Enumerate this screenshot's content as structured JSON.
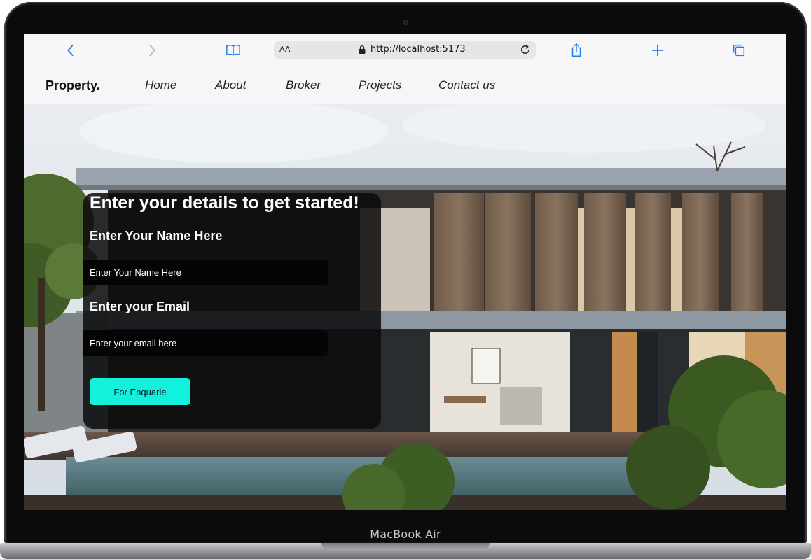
{
  "device": {
    "label": "MacBook Air"
  },
  "browser": {
    "text_size_label": "AA",
    "url": "http://localhost:5173",
    "icons": [
      "back-icon",
      "forward-icon",
      "bookmarks-icon",
      "lock-icon",
      "reload-icon",
      "share-icon",
      "new-tab-icon",
      "tabs-icon"
    ]
  },
  "site": {
    "logo": "Property.",
    "nav": [
      {
        "label": "Home"
      },
      {
        "label": "About"
      },
      {
        "label": "Broker"
      },
      {
        "label": "Projects"
      },
      {
        "label": "Contact us"
      }
    ]
  },
  "form": {
    "title": "Enter your details to get started!",
    "name_label": "Enter Your Name Here",
    "name_placeholder": "Enter Your Name Here",
    "email_label": "Enter your Email",
    "email_placeholder": "Enter your email here",
    "button_label": "For Enquarie"
  },
  "colors": {
    "accent": "#12f1dc",
    "browser_blue": "#1f7bf2",
    "card_bg": "#0a0a0c"
  }
}
